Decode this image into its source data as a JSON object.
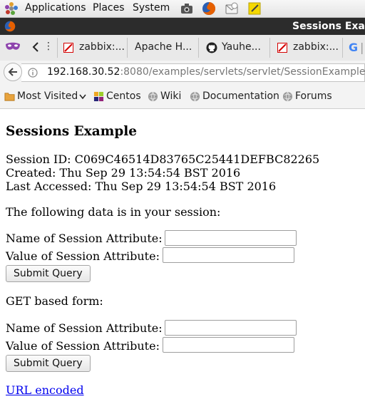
{
  "panel": {
    "applications": "Applications",
    "places": "Places",
    "system": "System"
  },
  "window": {
    "title": "Sessions Exa"
  },
  "tabs": [
    {
      "label": ""
    },
    {
      "label": "zabbix:..."
    },
    {
      "label": "Apache H..."
    },
    {
      "label": "Yauhe..."
    },
    {
      "label": "zabbix:..."
    },
    {
      "label": ""
    }
  ],
  "nav": {
    "url_host": "192.168.30.52",
    "url_rest": ":8080/examples/servlets/servlet/SessionExample"
  },
  "bookmarks": [
    {
      "label": "Most Visited"
    },
    {
      "label": "Centos"
    },
    {
      "label": "Wiki"
    },
    {
      "label": "Documentation"
    },
    {
      "label": "Forums"
    }
  ],
  "page": {
    "heading": "Sessions Example",
    "session_id": "Session ID: C069C46514D83765C25441DEFBC82265",
    "created": "Created: Thu Sep 29 13:54:54 BST 2016",
    "last_accessed": "Last Accessed: Thu Sep 29 13:54:54 BST 2016",
    "data_intro": "The following data is in your session:",
    "form1": {
      "name_label": "Name of Session Attribute:",
      "value_label": "Value of Session Attribute:",
      "name_value": "",
      "value_value": "",
      "submit": "Submit Query"
    },
    "get_label": "GET based form:",
    "form2": {
      "name_label": "Name of Session Attribute:",
      "value_label": "Value of Session Attribute:",
      "name_value": "",
      "value_value": "",
      "submit": "Submit Query"
    },
    "url_encoded": "URL encoded"
  },
  "colors": {
    "firefox_orange": "#e66000",
    "link_blue": "#0000ee",
    "titlebar": "#2c2c2c"
  },
  "icons": [
    "applications-logo-icon",
    "camera-icon",
    "firefox-icon",
    "mail-icon",
    "note-icon",
    "firefox-small-icon",
    "private-mask-icon",
    "chevron-left-icon",
    "zabbix-icon",
    "github-icon",
    "google-icon",
    "back-arrow-icon",
    "info-icon",
    "bookmarks-folder-icon",
    "centos-icon",
    "globe-icon"
  ]
}
